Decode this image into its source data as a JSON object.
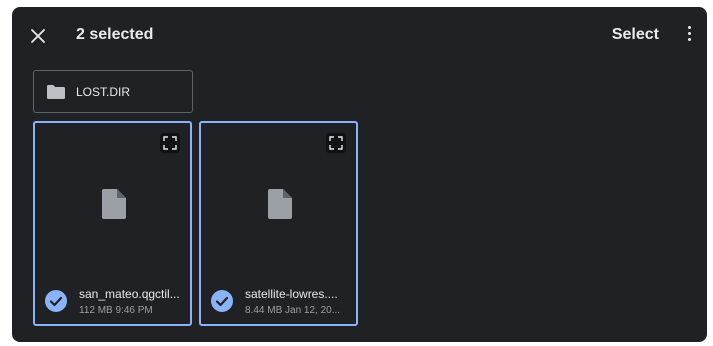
{
  "app_bar": {
    "close_icon": "close-icon",
    "title": "2 selected",
    "select_label": "Select",
    "more_icon": "more-vert-icon"
  },
  "folders": [
    {
      "name": "LOST.DIR",
      "icon": "folder-icon"
    }
  ],
  "files": [
    {
      "name": "san_mateo.qgctil...",
      "meta": "112 MB 9:46 PM",
      "selected": true,
      "icon": "document-icon"
    },
    {
      "name": "satellite-lowres....",
      "meta": "8.44 MB Jan 12, 20...",
      "selected": true,
      "icon": "document-icon"
    }
  ],
  "colors": {
    "background": "#202124",
    "selection_accent": "#8ab4f8",
    "text_primary": "#e8eaed",
    "text_secondary": "#9aa0a6"
  }
}
